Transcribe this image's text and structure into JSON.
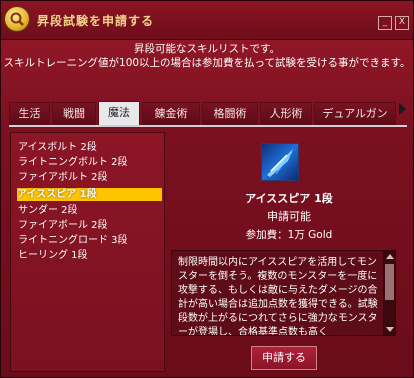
{
  "window": {
    "title": "昇段試験を申請する",
    "minimize_label": "_",
    "close_label": "X"
  },
  "description": {
    "line1": "昇段可能なスキルリストです。",
    "line2": "スキルトレーニング値が100以上の場合は参加費を払って試験を受ける事ができます。"
  },
  "tabs": [
    "生活",
    "戦闘",
    "魔法",
    "錬金術",
    "格闘術",
    "人形術",
    "デュアルガン"
  ],
  "active_tab": "魔法",
  "skills": [
    "アイスボルト 2段",
    "ライトニングボルト 2段",
    "ファイアボルト 2段",
    "アイススピア 1段",
    "サンダー 2段",
    "ファイアボール 2段",
    "ライトニングロード 3段",
    "ヒーリング 1段"
  ],
  "selected_skill_index": 3,
  "detail": {
    "skill_name": "アイススピア 1段",
    "status": "申請可能",
    "fee": "参加費：1万 Gold",
    "text": "制限時間以内にアイススピアを活用してモンスターを倒そう。複数のモンスターを一度に攻撃する、もしくは敵に与えたダメージの合計が高い場合は追加点数を獲得できる。試験段数が上がるにつれてさらに強力なモンスターが登場し、合格基準点数も高く",
    "apply_label": "申請する"
  },
  "colors": {
    "title": "#f3d28a",
    "selected": "#ffc400",
    "window": "#7a1020"
  }
}
